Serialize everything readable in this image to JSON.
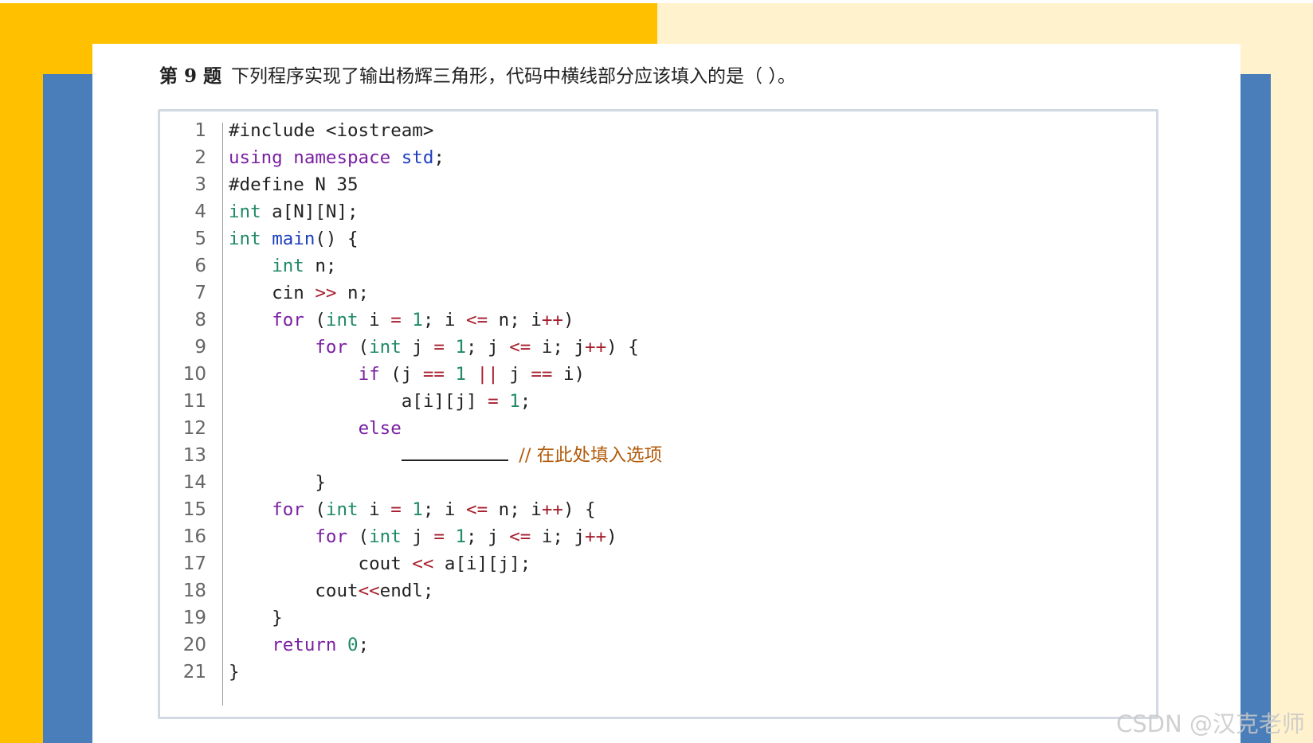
{
  "question": {
    "number_label": "第 9 题",
    "text": "下列程序实现了输出杨辉三角形，代码中横线部分应该填入的是（ ）。"
  },
  "code": {
    "line_numbers": [
      "1",
      "2",
      "3",
      "4",
      "5",
      "6",
      "7",
      "8",
      "9",
      "10",
      "11",
      "12",
      "13",
      "14",
      "15",
      "16",
      "17",
      "18",
      "19",
      "20",
      "21"
    ],
    "blank_comment": "// 在此处填入选项"
  },
  "watermark": "CSDN @汉克老师",
  "colors": {
    "background_yellow": "#ffc000",
    "background_cream": "#fff2cc",
    "background_blue": "#4a7ebb",
    "keyword_purple": "#7a1fa2",
    "type_green": "#1f8a66",
    "operator_red": "#a61d2c",
    "comment_orange": "#b25b0b"
  }
}
